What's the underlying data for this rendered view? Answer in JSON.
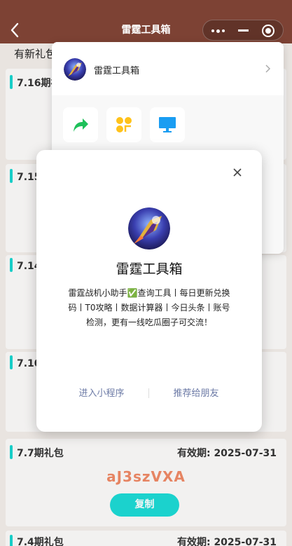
{
  "header": {
    "title": "雷霆工具箱"
  },
  "page": {
    "notice": "有新礼包",
    "gifts": [
      {
        "title": "7.16期礼包",
        "expiry": ""
      },
      {
        "title": "7.15期礼包",
        "expiry": ""
      },
      {
        "title": "7.14期礼包",
        "expiry": ""
      },
      {
        "title": "7.10期礼包",
        "expiry": ""
      },
      {
        "title": "7.7期礼包",
        "expiry": "有效期: 2025-07-31",
        "code": "aJ3szVXA",
        "copy_label": "复制"
      },
      {
        "title": "7.4期礼包",
        "expiry": "有效期: 2025-07-31"
      }
    ]
  },
  "share_sheet": {
    "app_name": "雷霆工具箱"
  },
  "dialog": {
    "title": "雷霆工具箱",
    "description": "雷霆战机小助手✅查询工具丨每日更新兑换码丨T0攻略丨数据计算器丨今日头条丨账号检测，更有一线吃瓜圈子可交流！",
    "enter_label": "进入小程序",
    "share_label": "推荐给朋友"
  },
  "colors": {
    "header_bg": "#7d4234",
    "accent": "#1ddbd6",
    "code": "#f08a66",
    "link": "#6c7aa6"
  }
}
